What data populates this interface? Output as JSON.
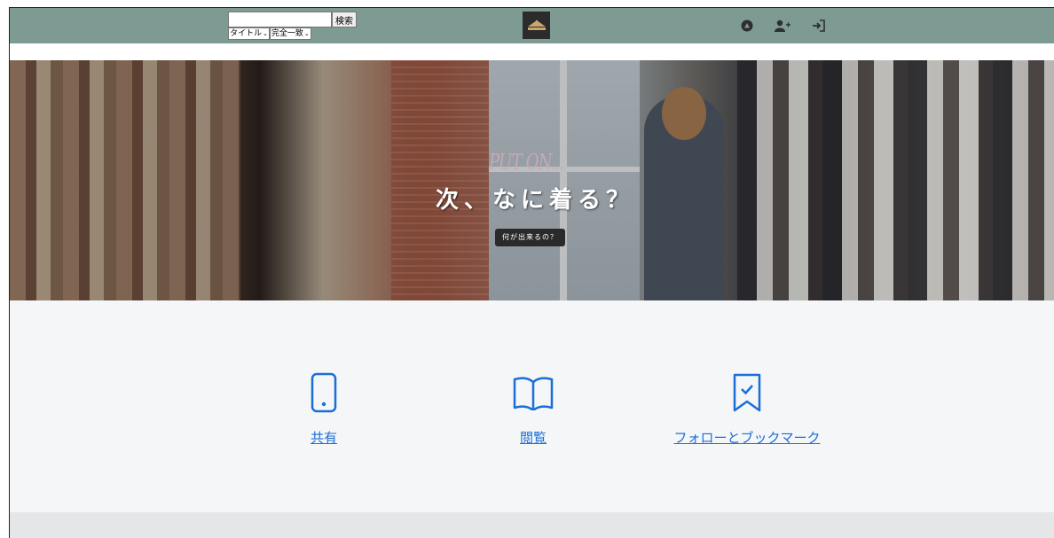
{
  "search": {
    "input_value": "",
    "button_label": "検索",
    "field_select": "タイトル",
    "mode_select": "完全一致"
  },
  "nav": {
    "logo": "logo-icon",
    "icons": [
      "user-circle-icon",
      "user-plus-icon",
      "sign-in-icon"
    ]
  },
  "hero": {
    "sub_title": "PUT ON...",
    "title": "次、なに着る？",
    "button_label": "何が出来るの？"
  },
  "features": [
    {
      "icon": "mobile-icon",
      "label": "共有"
    },
    {
      "icon": "book-icon",
      "label": "閲覧"
    },
    {
      "icon": "bookmark-check-icon",
      "label": "フォローとブックマーク"
    }
  ],
  "colors": {
    "navbar": "#7d9b92",
    "link": "#1a6fd6",
    "footer": "#e5e6e7"
  }
}
